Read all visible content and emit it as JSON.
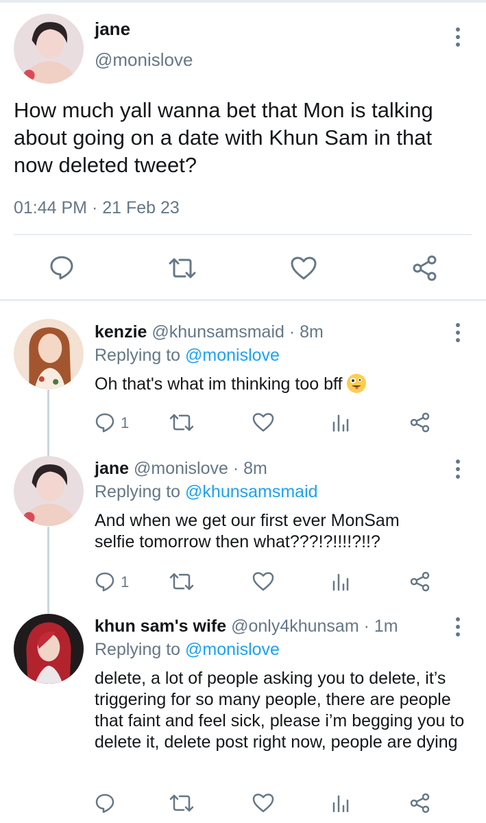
{
  "main_tweet": {
    "name": "jane",
    "handle": "@monislove",
    "text": "How much yall wanna bet that Mon is talking about going on a date with Khun Sam in that now deleted tweet?",
    "timestamp": "01:44 PM · 21 Feb 23"
  },
  "replies": [
    {
      "name": "kenzie",
      "handle": "@khunsamsmaid",
      "time": "· 8m",
      "replying_label": "Replying to",
      "replying_to": "@monislove",
      "text": "Oh that's what im thinking too bff",
      "reply_count": "1"
    },
    {
      "name": "jane",
      "handle": "@monislove",
      "time": "· 8m",
      "replying_label": "Replying to",
      "replying_to": "@khunsamsmaid",
      "text": "And when we get our first ever MonSam selfie tomorrow then what???!?!!!!?!!?",
      "reply_count": "1"
    },
    {
      "name": "khun sam's wife",
      "handle": "@only4khunsam",
      "time": "· 1m",
      "replying_label": "Replying to",
      "replying_to": "@monislove",
      "text": "delete, a lot of people asking you to delete, it’s triggering for so many people, there are people that faint and feel sick, please i’m begging you to delete it, delete post right now, people are dying",
      "reply_count": ""
    }
  ],
  "colors": {
    "text": "#14171a",
    "secondary": "#657786",
    "accent": "#1da1f2",
    "divider": "#e6ecf0"
  },
  "icons": [
    "reply-icon",
    "retweet-icon",
    "like-icon",
    "share-icon",
    "analytics-icon",
    "more-icon",
    "zany-face-emoji"
  ]
}
